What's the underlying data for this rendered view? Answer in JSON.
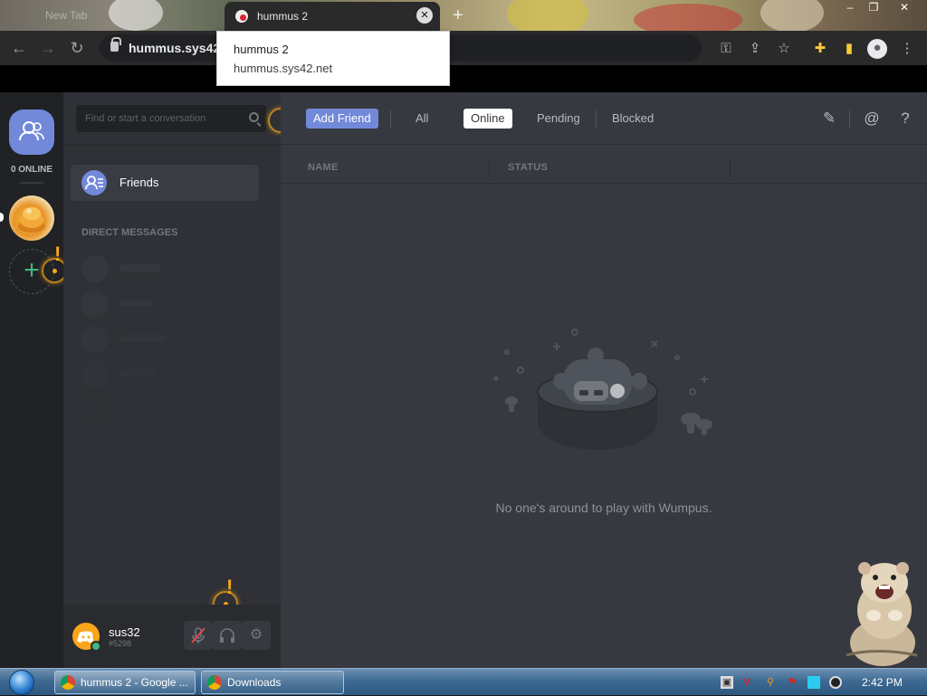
{
  "browser": {
    "tabs": [
      {
        "title": "New Tab",
        "active": false
      },
      {
        "title": "hummus 2",
        "active": true
      }
    ],
    "new_tab_label": "+",
    "url": "hummus.sys42.n",
    "tooltip": {
      "title": "hummus 2",
      "url": "hummus.sys42.net"
    },
    "window_controls": [
      "–",
      "❐",
      "✕"
    ]
  },
  "discord": {
    "guilds": {
      "online_label": "0 ONLINE",
      "add_server_label": "+"
    },
    "search": {
      "placeholder": "Find or start a conversation"
    },
    "friends_label": "Friends",
    "dm_header": "DIRECT MESSAGES",
    "user": {
      "name": "sus32",
      "tag": "#5298"
    },
    "topbar": {
      "add_friend": "Add Friend",
      "tabs": [
        "All",
        "Online",
        "Pending",
        "Blocked"
      ],
      "selected_tab": "Online"
    },
    "columns": {
      "name": "NAME",
      "status": "STATUS"
    },
    "empty_state": "No one's around to play with Wumpus.",
    "beacon_mark": "!"
  },
  "taskbar": {
    "buttons": [
      "hummus 2 - Google ...",
      "Downloads"
    ],
    "clock": "2:42 PM"
  },
  "colors": {
    "blurple": "#7289da",
    "background_dark": "#202225",
    "background_secondary": "#2f3136",
    "background_primary": "#36393f",
    "online_green": "#43b581",
    "beacon_orange": "#faa61a"
  },
  "icons": [
    "back-arrow-icon",
    "forward-arrow-icon",
    "reload-icon",
    "lock-icon",
    "key-icon",
    "share-icon",
    "star-icon",
    "extensions-icon",
    "sidebar-icon",
    "profile-icon",
    "menu-icon",
    "search-icon",
    "new-group-dm-icon",
    "mention-icon",
    "help-icon",
    "mute-icon",
    "headset-icon",
    "settings-icon"
  ]
}
